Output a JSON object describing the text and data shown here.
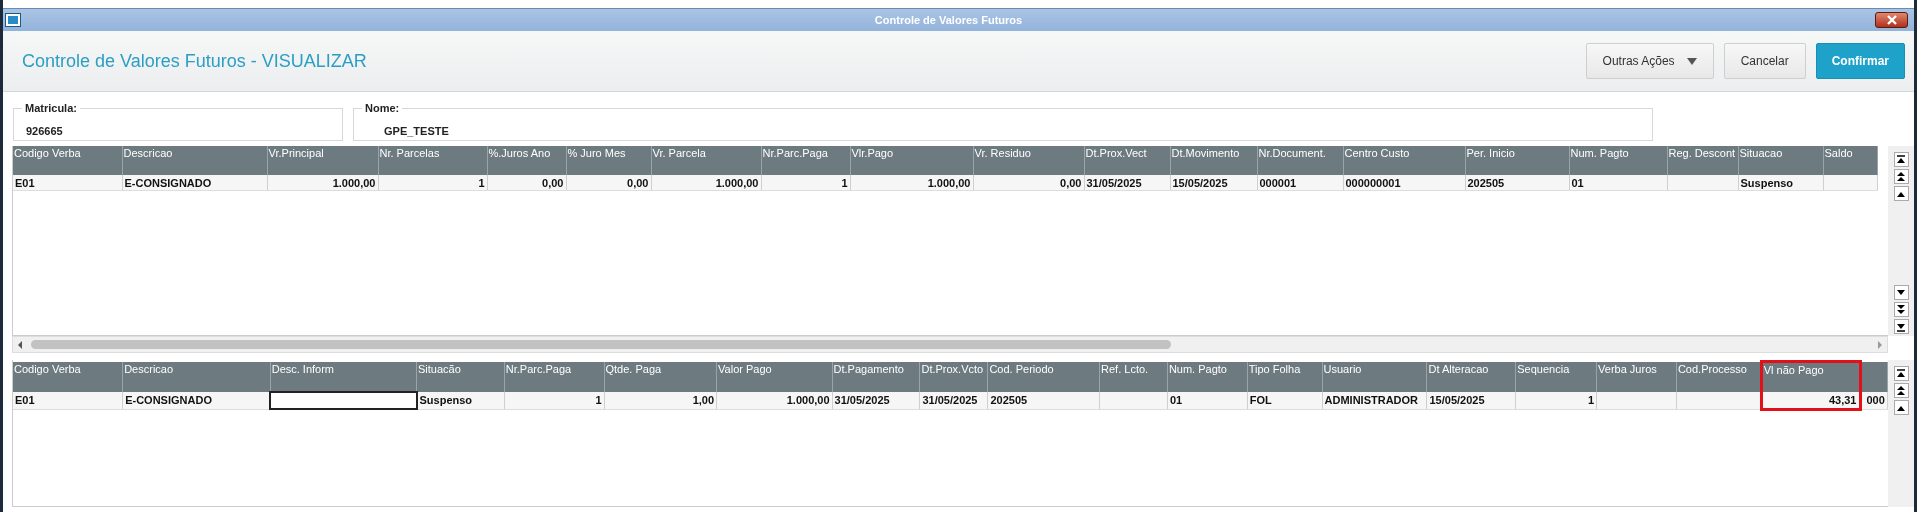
{
  "window": {
    "title": "Controle de Valores Futuros"
  },
  "header": {
    "title": "Controle de Valores Futuros - VISUALIZAR",
    "buttons": [
      {
        "label": "Outras Ações",
        "kind": "menu"
      },
      {
        "label": "Cancelar",
        "kind": "plain"
      },
      {
        "label": "Confirmar",
        "kind": "primary"
      }
    ]
  },
  "fields": [
    {
      "label": "Matricula:",
      "value": "926665"
    },
    {
      "label": "Nome:",
      "value": "GPE_TESTE"
    }
  ],
  "tables": [
    {
      "columns": [
        {
          "label": "Codigo Verba",
          "numeric": false
        },
        {
          "label": "Descricao",
          "numeric": false
        },
        {
          "label": "Vr.Principal",
          "numeric": true
        },
        {
          "label": "Nr. Parcelas",
          "numeric": true
        },
        {
          "label": "%.Juros Ano",
          "numeric": true
        },
        {
          "label": "% Juro Mes",
          "numeric": true
        },
        {
          "label": "Vr. Parcela",
          "numeric": true
        },
        {
          "label": "Nr.Parc.Paga",
          "numeric": true
        },
        {
          "label": "Vlr.Pago",
          "numeric": true
        },
        {
          "label": "Vr. Residuo",
          "numeric": true
        },
        {
          "label": "Dt.Prox.Vect",
          "numeric": false
        },
        {
          "label": "Dt.Movimento",
          "numeric": false
        },
        {
          "label": "Nr.Document.",
          "numeric": false
        },
        {
          "label": "Centro Custo",
          "numeric": false
        },
        {
          "label": "Per. Inicio",
          "numeric": false
        },
        {
          "label": "Num. Pagto",
          "numeric": false
        },
        {
          "label": "Reg. Descont"
        },
        {
          "label": "Situacao",
          "numeric": false
        },
        {
          "label": "Saldo"
        }
      ],
      "rows": [
        {
          "cells": [
            "E01",
            "E-CONSIGNADO",
            "1.000,00",
            "1",
            "0,00",
            "0,00",
            "1.000,00",
            "1",
            "1.000,00",
            "0,00",
            "31/05/2025",
            "15/05/2025",
            "000001",
            "000000001",
            "202505",
            "01",
            "",
            "Suspenso",
            ""
          ]
        }
      ],
      "horizontal_scrollbar": true
    },
    {
      "columns": [
        {
          "label": "Codigo Verba",
          "numeric": false
        },
        {
          "label": "Descricao",
          "numeric": false
        },
        {
          "label": "Desc. Inform",
          "editing": true
        },
        {
          "label": "Situacão",
          "numeric": false
        },
        {
          "label": "Nr.Parc.Paga",
          "numeric": true
        },
        {
          "label": "Qtde. Paga",
          "numeric": true
        },
        {
          "label": "Valor Pago",
          "numeric": true
        },
        {
          "label": "Dt.Pagamento",
          "numeric": false
        },
        {
          "label": "Dt.Prox.Vcto",
          "numeric": false
        },
        {
          "label": "Cod. Periodo",
          "numeric": false
        },
        {
          "label": "Ref. Lcto."
        },
        {
          "label": "Num. Pagto",
          "numeric": false
        },
        {
          "label": "Tipo Folha",
          "numeric": false
        },
        {
          "label": "Usuario",
          "numeric": false
        },
        {
          "label": "Dt Alteracao",
          "numeric": false
        },
        {
          "label": "Sequencia",
          "numeric": true
        },
        {
          "label": "Verba Juros"
        },
        {
          "label": "Cod.Processo"
        },
        {
          "label": "Vl não Pago",
          "numeric": true,
          "highlighted": true
        },
        {
          "numeric": false
        }
      ],
      "rows": [
        {
          "cells": [
            "E01",
            "E-CONSIGNADO",
            "",
            "Suspenso",
            "1",
            "1,00",
            "1.000,00",
            "31/05/2025",
            "31/05/2025",
            "202505",
            "",
            "01",
            "FOL",
            "ADMINISTRADOR",
            "15/05/2025",
            "1",
            "",
            "",
            "43,31",
            "000"
          ]
        }
      ]
    }
  ]
}
